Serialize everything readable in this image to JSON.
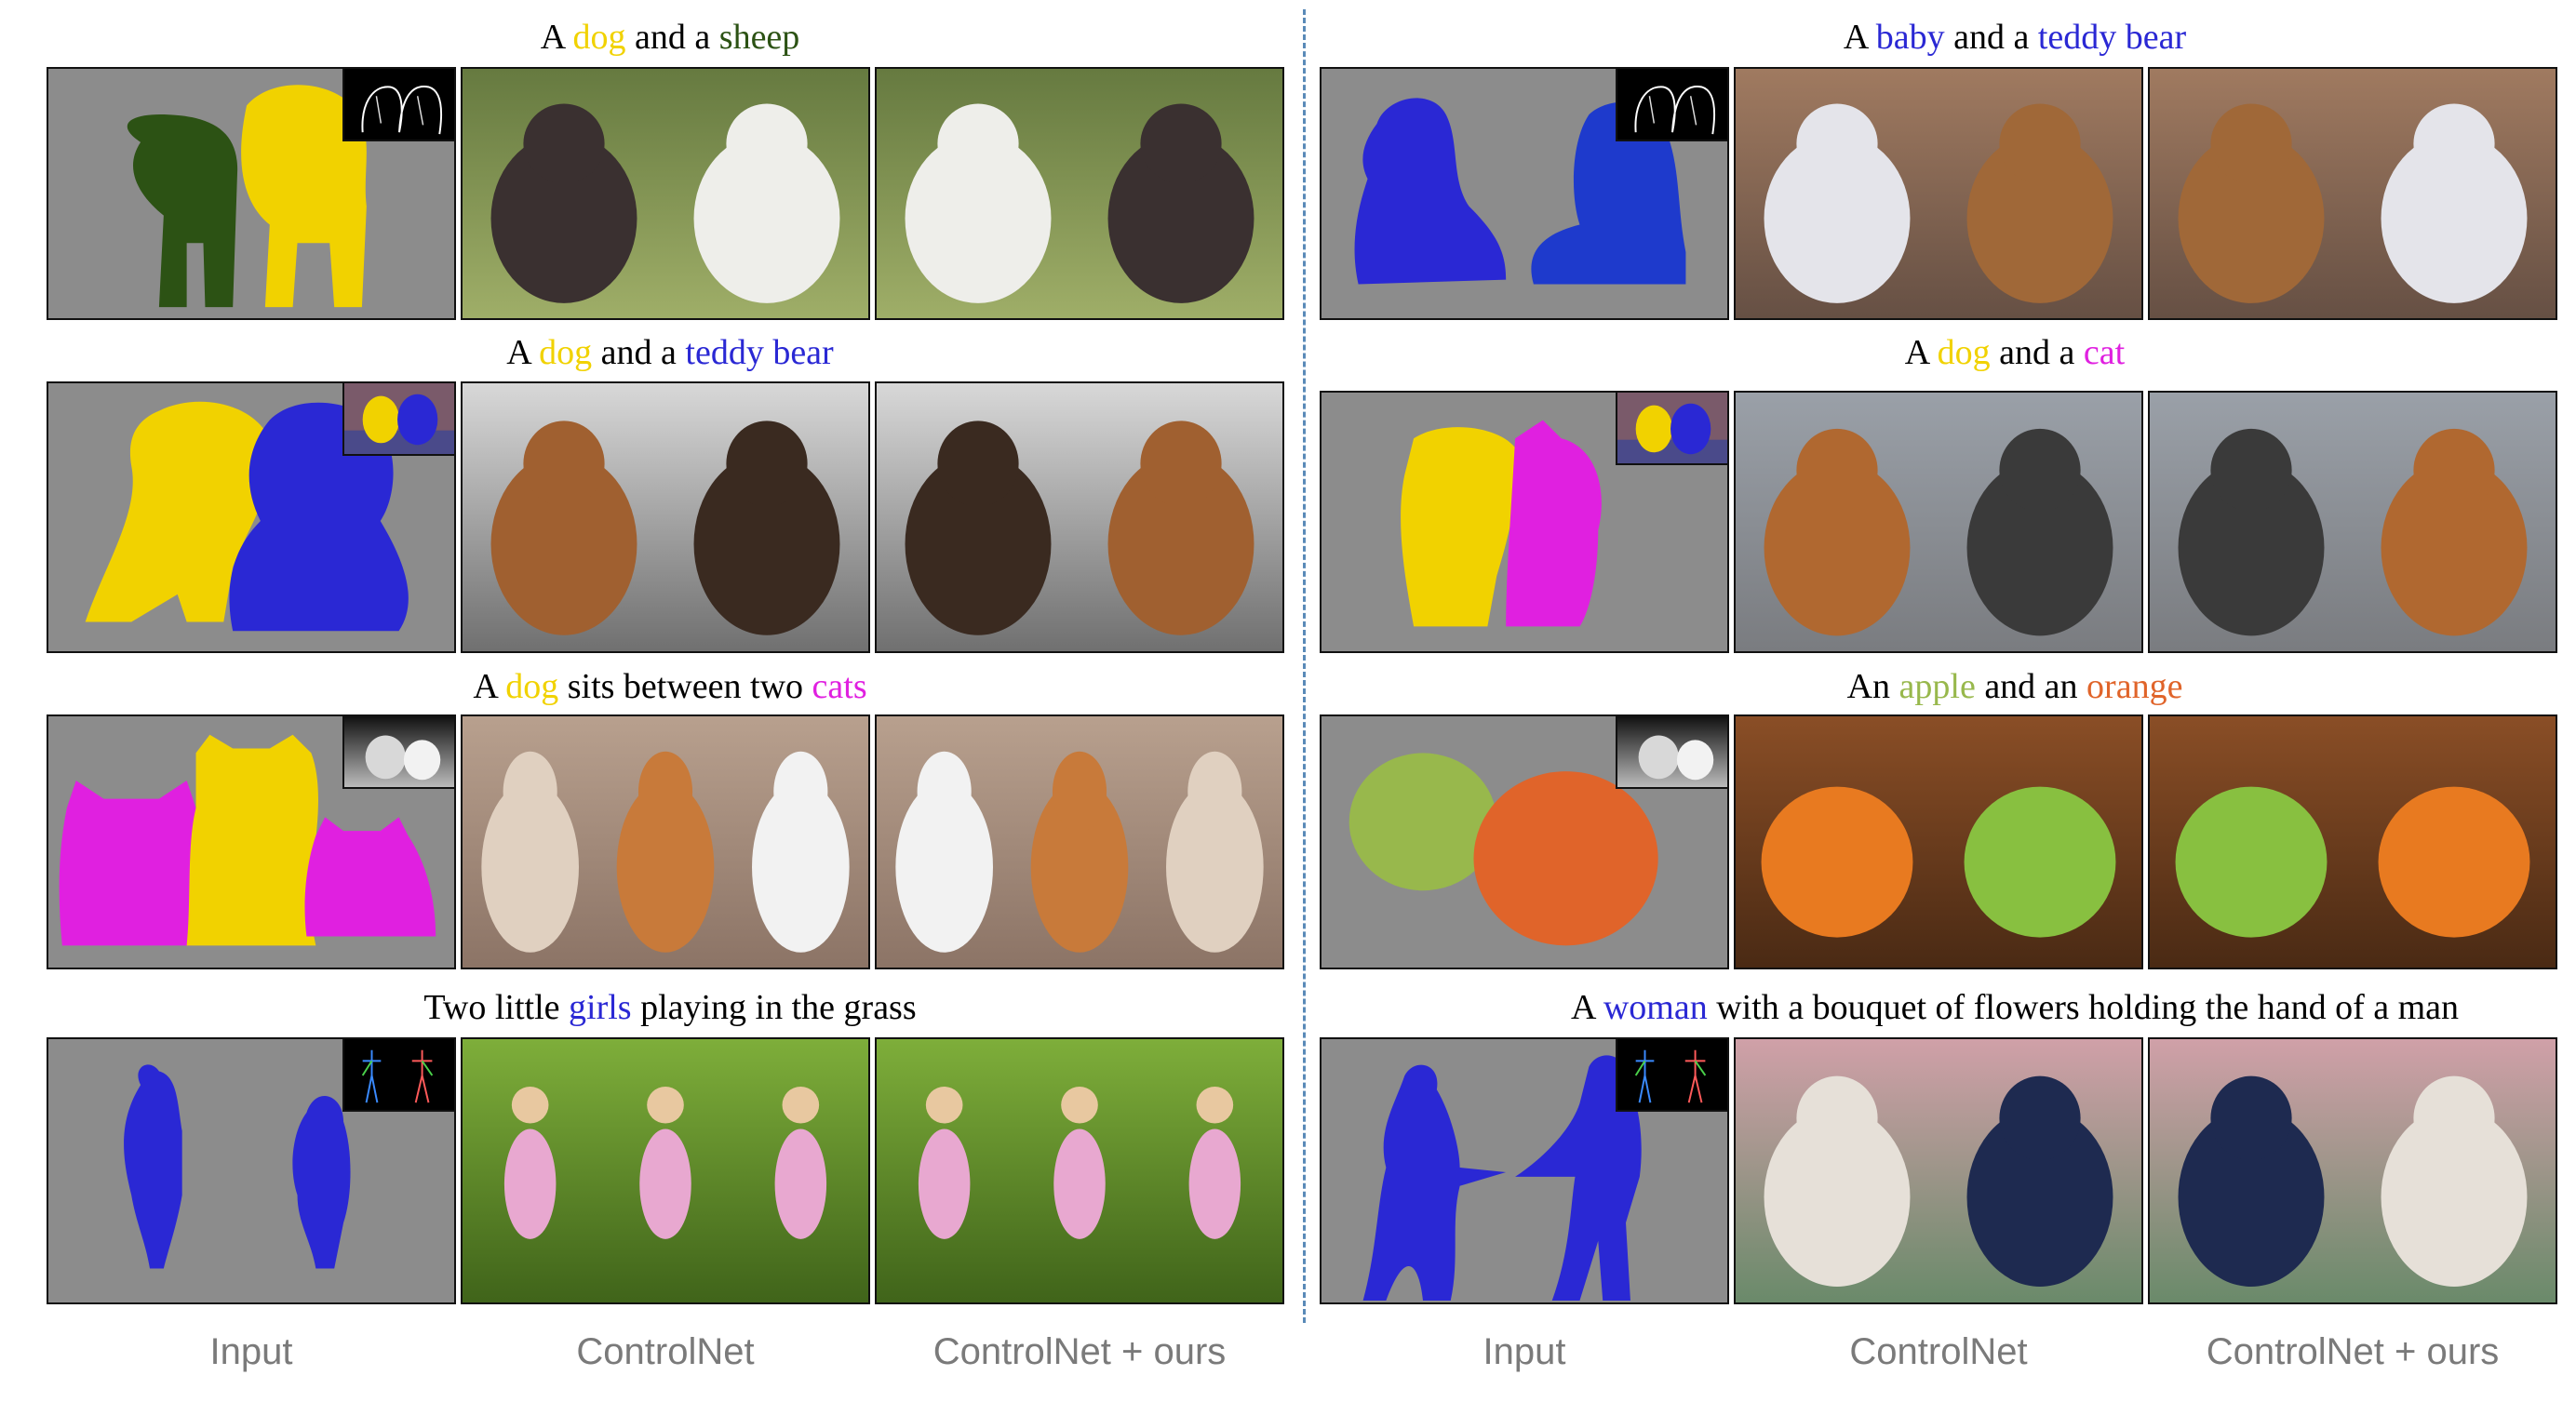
{
  "colors": {
    "yellow": "#f1d200",
    "dark_green": "#2c5214",
    "blue": "#2a28d4",
    "magenta": "#e020e0",
    "apple_green": "#98b84c",
    "orange": "#e0642a",
    "label_gray": "#7a7a7a",
    "divider": "#5a8ab8"
  },
  "left": {
    "rows": [
      {
        "caption": [
          {
            "t": "A "
          },
          {
            "t": "dog",
            "c": "yellow"
          },
          {
            "t": " and a "
          },
          {
            "t": "sheep",
            "c": "dark_green"
          }
        ],
        "inset": "edges"
      },
      {
        "caption": [
          {
            "t": "A "
          },
          {
            "t": "dog",
            "c": "yellow"
          },
          {
            "t": " and a "
          },
          {
            "t": "teddy bear",
            "c": "blue"
          }
        ],
        "inset": "color"
      },
      {
        "caption": [
          {
            "t": "A "
          },
          {
            "t": "dog",
            "c": "yellow"
          },
          {
            "t": " sits between two "
          },
          {
            "t": "cats",
            "c": "magenta"
          }
        ],
        "inset": "depth"
      },
      {
        "caption": [
          {
            "t": "Two little "
          },
          {
            "t": "girls",
            "c": "blue"
          },
          {
            "t": " playing in the grass"
          }
        ],
        "inset": "pose"
      }
    ]
  },
  "right": {
    "rows": [
      {
        "caption": [
          {
            "t": "A "
          },
          {
            "t": "baby",
            "c": "blue"
          },
          {
            "t": " and a "
          },
          {
            "t": "teddy bear",
            "c": "blue"
          }
        ],
        "inset": "edges"
      },
      {
        "caption": [
          {
            "t": "A "
          },
          {
            "t": "dog",
            "c": "yellow"
          },
          {
            "t": " and a "
          },
          {
            "t": "cat",
            "c": "magenta"
          }
        ],
        "inset": "color"
      },
      {
        "caption": [
          {
            "t": "An "
          },
          {
            "t": "apple",
            "c": "apple_green"
          },
          {
            "t": " and an "
          },
          {
            "t": "orange",
            "c": "orange"
          }
        ],
        "inset": "depth"
      },
      {
        "caption": [
          {
            "t": "A "
          },
          {
            "t": "woman",
            "c": "blue"
          },
          {
            "t": " with a bouquet of flowers holding the hand of a man"
          }
        ],
        "inset": "pose"
      }
    ]
  },
  "column_labels": [
    "Input",
    "ControlNet",
    "ControlNet + ours",
    "Input",
    "ControlNet",
    "ControlNet + ours"
  ]
}
